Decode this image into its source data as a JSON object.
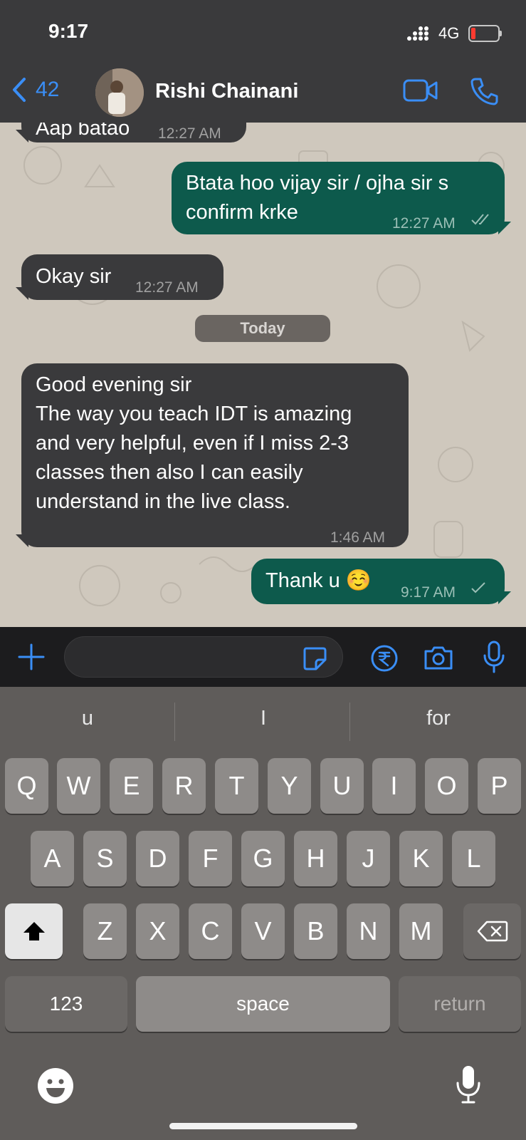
{
  "status": {
    "time": "9:17",
    "network": "4G"
  },
  "header": {
    "back_count": "42",
    "contact_name": "Rishi Chainani"
  },
  "messages": [
    {
      "direction": "in",
      "text": "Aap batao",
      "time": "12:27 AM"
    },
    {
      "direction": "out",
      "text_lines": [
        "Btata hoo vijay sir / ojha sir s",
        "confirm krke"
      ],
      "time": "12:27 AM",
      "ticks": "read"
    },
    {
      "direction": "in",
      "text": "Okay sir",
      "time": "12:27 AM"
    },
    {
      "direction": "in",
      "text_lines": [
        "Good evening sir",
        "The way you teach IDT is amazing",
        "and very helpful, even if I miss 2-3",
        "classes then also I can easily",
        "understand in the live class."
      ],
      "time": "1:46 AM"
    },
    {
      "direction": "out",
      "text": "Thank u ☺️",
      "time": "9:17 AM",
      "ticks": "sent"
    }
  ],
  "date_separator": "Today",
  "composer": {
    "placeholder": ""
  },
  "keyboard": {
    "suggestions": [
      "u",
      "I",
      "for"
    ],
    "row1": [
      "Q",
      "W",
      "E",
      "R",
      "T",
      "Y",
      "U",
      "I",
      "O",
      "P"
    ],
    "row2": [
      "A",
      "S",
      "D",
      "F",
      "G",
      "H",
      "J",
      "K",
      "L"
    ],
    "row3": [
      "Z",
      "X",
      "C",
      "V",
      "B",
      "N",
      "M"
    ],
    "numbers_label": "123",
    "space_label": "space",
    "return_label": "return"
  },
  "colors": {
    "accent": "#3a8ef6",
    "outgoing_bubble": "#0d5a4c",
    "incoming_bubble": "#3a3a3c",
    "chat_bg": "#cfc8bd"
  }
}
